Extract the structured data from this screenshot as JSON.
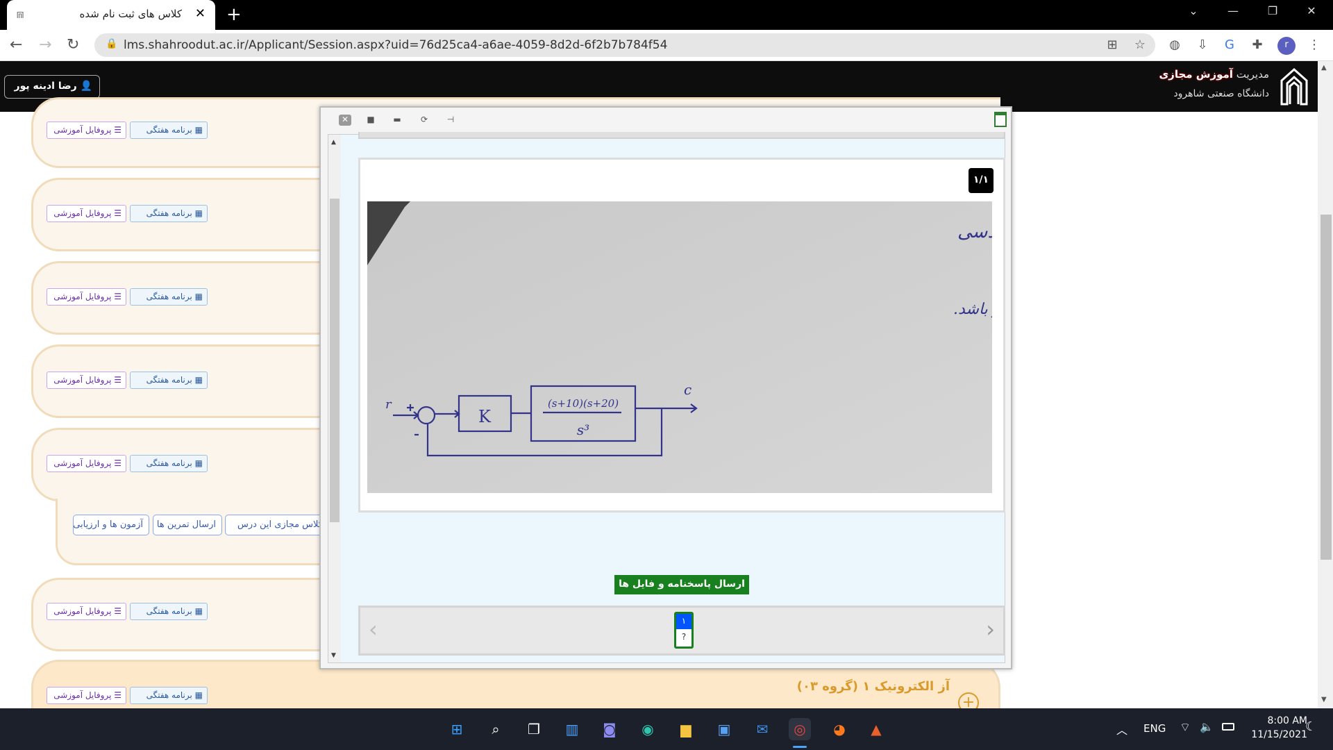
{
  "browser": {
    "tab_title": "کلاس های ثبت نام شده",
    "url": "lms.shahroodut.ac.ir/Applicant/Session.aspx?uid=76d25ca4-a6ae-4059-8d2d-6f2b7b784f54",
    "profile_initial": "r"
  },
  "header": {
    "user_name": "رضا ادینه پور",
    "brand_prefix": "مدیریت",
    "brand_bold": "آموزش مجازی",
    "university": "دانشگاه صنعتی شاهرود"
  },
  "cards": {
    "profile_label": "پروفایل آموزشی",
    "schedule_label": "برنامه هفتگی",
    "last_course_title": "آز الکترونیک ۱ (گروه ۰۳)"
  },
  "subpanel": {
    "buttons": [
      "کلاس مجازی این درس",
      "ارسال تمرین ها",
      "آزمون ها و ارزیابی"
    ]
  },
  "dialog": {
    "page_badge": "۱/۱",
    "send_button": "ارسال پاسخنامه و فایل ها",
    "page_number": "۱",
    "page_status": "?",
    "image": {
      "title": "کوییز کنترل خطی مهندسی",
      "question": "برای سیستم حلقه بسته زیر، مقدار K را طوری تعیین کنید که سیستم حلقه بسته پایدار باشد.",
      "r": "r",
      "c": "c",
      "k": "K",
      "numerator": "(s+10)(s+20)",
      "denominator": "s³"
    }
  },
  "taskbar": {
    "lang": "ENG",
    "time": "8:00 AM",
    "date": "11/15/2021"
  },
  "colors": {
    "accent_green": "#18801f",
    "page_blue": "#0055ff",
    "course_orange": "#d99a2b"
  }
}
